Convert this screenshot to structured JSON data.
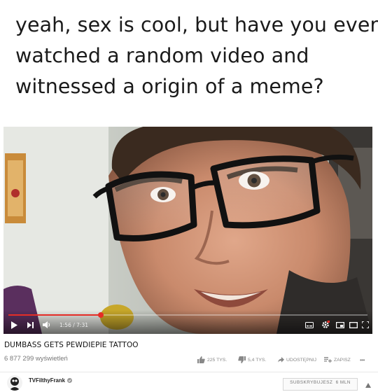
{
  "meme_caption": {
    "lines": [
      "yeah, sex is cool, but have you ever",
      "watched a random video and",
      "witnessed a origin of a meme?"
    ]
  },
  "player": {
    "current_time": "1:56",
    "separator": " / ",
    "duration": "7:31",
    "progress_fraction": 0.257,
    "progress_color": "#e52d27",
    "icons": [
      "play-icon",
      "next-icon",
      "volume-icon",
      "subtitles-icon",
      "settings-icon",
      "miniplayer-icon",
      "theater-icon",
      "fullscreen-icon"
    ]
  },
  "video": {
    "title": "DUMBASS GETS PEWDIEPIE TATTOO",
    "views": "6 877 299 wyświetleń"
  },
  "actions": {
    "likes": "225 TYS.",
    "dislikes": "5,4 TYS.",
    "share": "UDOSTĘPNIJ",
    "save": "ZAPISZ",
    "more": "•••"
  },
  "channel": {
    "name": "TVFilthyFrank",
    "verified_icon": "verified-check-icon"
  },
  "subscribe": {
    "label": "SUBSKRYBUJESZ  6 MLN"
  }
}
